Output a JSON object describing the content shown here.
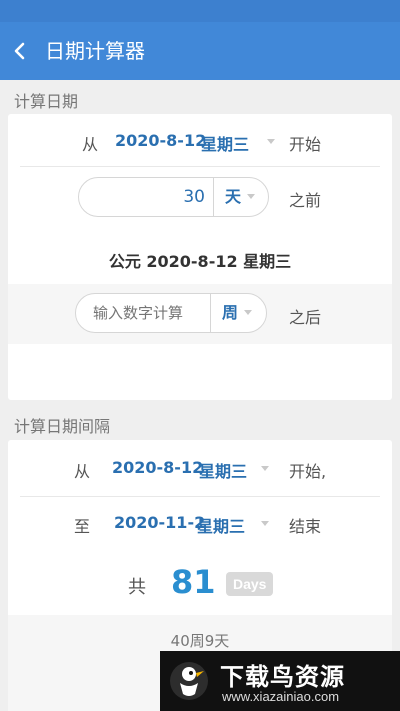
{
  "app": {
    "title": "日期计算器"
  },
  "calc_date": {
    "section_title": "计算日期",
    "from_label": "从",
    "base_date": "2020-8-12",
    "base_weekday": "星期三",
    "start_label": "开始",
    "before": {
      "value": "30",
      "unit": "天",
      "suffix": "之前"
    },
    "result": "公元 2020-8-12  星期三",
    "after": {
      "value": "",
      "placeholder": "输入数字计算",
      "unit": "周",
      "suffix": "之后"
    }
  },
  "interval": {
    "section_title": "计算日期间隔",
    "from_label": "从",
    "start_date": "2020-8-12",
    "start_weekday": "星期三",
    "start_suffix": "开始,",
    "to_label": "至",
    "end_date": "2020-11-2",
    "end_weekday": "星期三",
    "end_suffix": "结束",
    "total_label": "共",
    "total_value": "81",
    "total_unit": "Days",
    "weeks_days": "40周9天"
  },
  "watermark": {
    "main": "下载鸟资源",
    "sub": "www.xiazainiao.com"
  },
  "colors": {
    "appbar": "#4188d8",
    "accent": "#2a6fb0",
    "total": "#2a8ed0"
  }
}
